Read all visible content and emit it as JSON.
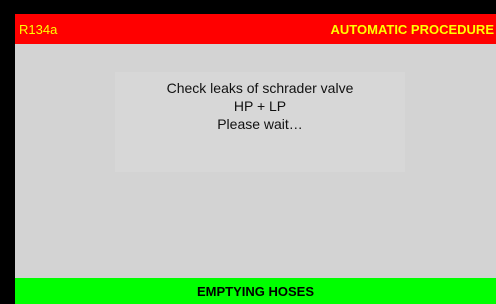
{
  "header": {
    "refrigerant": "R134a",
    "mode": "AUTOMATIC PROCEDURE"
  },
  "message": {
    "line1": "Check leaks of schrader valve",
    "line2": "HP + LP",
    "line3": "Please wait…"
  },
  "status": {
    "label": "EMPTYING HOSES"
  },
  "colors": {
    "header_background": "#ff0000",
    "header_text": "#ffff00",
    "screen_background": "#d3d3d3",
    "status_background": "#00ff00",
    "status_text": "#000000"
  }
}
